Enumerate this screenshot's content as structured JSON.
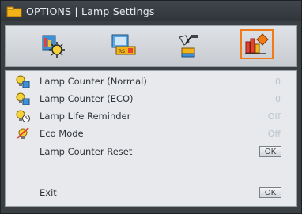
{
  "window": {
    "title": "OPTIONS | Lamp Settings"
  },
  "tabs": [
    {
      "icon": "image-settings-icon",
      "active": false
    },
    {
      "icon": "display-settings-icon",
      "active": false
    },
    {
      "icon": "setup-icon",
      "active": false
    },
    {
      "icon": "options-icon",
      "active": true
    }
  ],
  "menu": {
    "items": [
      {
        "label": "Lamp Counter (Normal)",
        "value": "0",
        "icon": "lamp-counter-normal-icon"
      },
      {
        "label": "Lamp Counter (ECO)",
        "value": "0",
        "icon": "lamp-counter-eco-icon"
      },
      {
        "label": "Lamp Life Reminder",
        "value": "Off",
        "icon": "lamp-reminder-icon"
      },
      {
        "label": "Eco Mode",
        "value": "Off",
        "icon": "eco-mode-icon"
      },
      {
        "label": "Lamp Counter Reset",
        "button": "OK"
      }
    ],
    "exit": {
      "label": "Exit",
      "button": "OK"
    }
  },
  "colors": {
    "accent": "#ef7a17",
    "panel": "#e7e9ec",
    "value_text": "#b8c4cc"
  }
}
